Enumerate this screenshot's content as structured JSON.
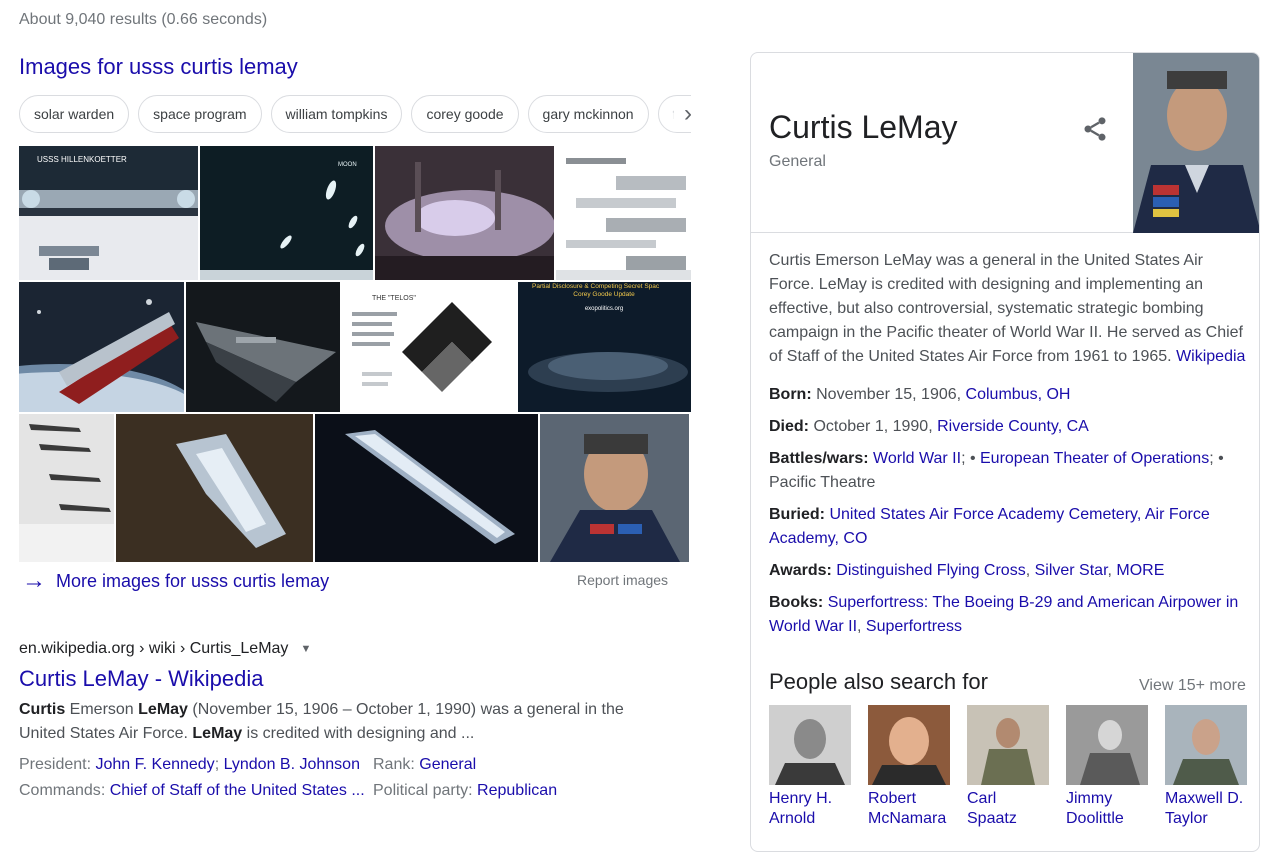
{
  "results_stats": "About 9,040 results (0.66 seconds)",
  "images": {
    "heading": "Images for usss curtis lemay",
    "chips": [
      "solar warden",
      "space program",
      "william tompkins",
      "corey goode",
      "gary mckinnon",
      "fleet"
    ],
    "tile_text": {
      "hillenkoetter": "USSS HILLENKOETTER",
      "moon": "MOON",
      "telos": "THE \"TELOS\"",
      "disclosure": "Partial Disclosure & Competing Secret Spac",
      "corey": "Corey Goode Update",
      "site": "exopolitics.org"
    },
    "more_label": "More images for usss curtis lemay",
    "report_label": "Report images"
  },
  "result": {
    "cite": "en.wikipedia.org › wiki › Curtis_LeMay",
    "title": "Curtis LeMay - Wikipedia",
    "snippet": {
      "b1": "Curtis",
      "t1": " Emerson ",
      "b2": "LeMay",
      "t2": " (November 15, 1906 – October 1, 1990) was a general in the United States Air Force. ",
      "b3": "LeMay",
      "t3": " is credited with designing and ..."
    },
    "facts": {
      "president_label": "President",
      "president_v1": "John F. Kennedy",
      "president_v2": "Lyndon B. Johnson",
      "rank_label": "Rank",
      "rank_value": "General",
      "commands_label": "Commands",
      "commands_value": "Chief of Staff of the United States ...",
      "party_label": "Political party",
      "party_value": "Republican"
    }
  },
  "knowledge_panel": {
    "title": "Curtis LeMay",
    "subtitle": "General",
    "description": "Curtis Emerson LeMay was a general in the United States Air Force. LeMay is credited with designing and implementing an effective, but also controversial, systematic strategic bombing campaign in the Pacific theater of World War II. He served as Chief of Staff of the United States Air Force from 1961 to 1965.",
    "description_link": "Wikipedia",
    "facts": {
      "born": {
        "label": "Born:",
        "text": "November 15, 1906, ",
        "link": "Columbus, OH"
      },
      "died": {
        "label": "Died:",
        "text": "October 1, 1990, ",
        "link": "Riverside County, CA"
      },
      "battles": {
        "label": "Battles/wars:",
        "link1": "World War II",
        "sep1": "; • ",
        "link2": "European Theater of Operations",
        "sep2": "; • ",
        "text": "Pacific Theatre"
      },
      "buried": {
        "label": "Buried:",
        "link": "United States Air Force Academy Cemetery, Air Force Academy, CO"
      },
      "awards": {
        "label": "Awards:",
        "link1": "Distinguished Flying Cross",
        "link2": "Silver Star",
        "link3": "MORE"
      },
      "books": {
        "label": "Books:",
        "link1": "Superfortress: The Boeing B-29 and American Airpower in World War II",
        "link2": "Superfortress"
      }
    },
    "people": {
      "heading": "People also search for",
      "view_more": "View 15+ more",
      "items": [
        {
          "name": "Henry H. Arnold"
        },
        {
          "name": "Robert McNamara"
        },
        {
          "name": "Carl Spaatz"
        },
        {
          "name": "Jimmy Doolittle"
        },
        {
          "name": "Maxwell D. Taylor"
        }
      ]
    }
  }
}
